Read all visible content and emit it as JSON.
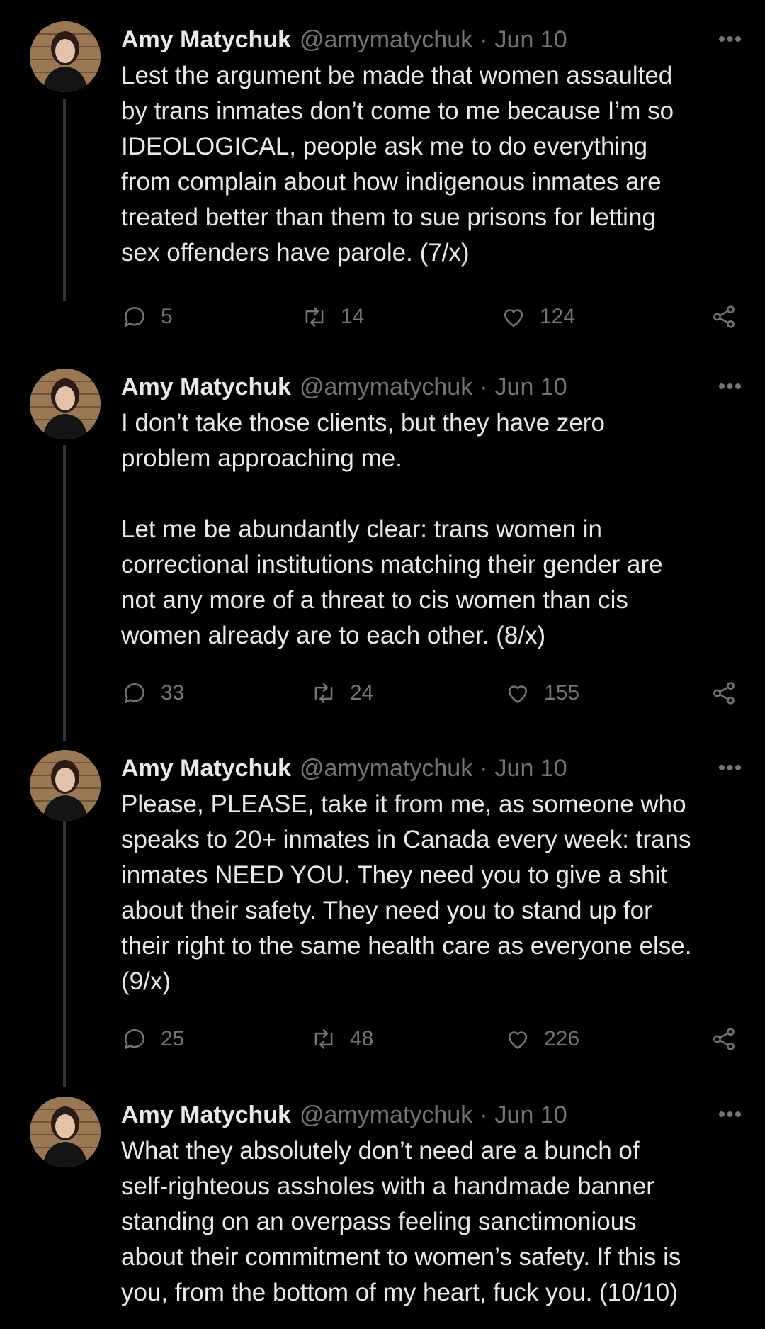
{
  "tweets": [
    {
      "name": "Amy Matychuk",
      "handle": "@amymatychuk",
      "separator": "·",
      "date": "Jun 10",
      "more": "•••",
      "text": "Lest the argument be made that women assaulted\nby trans inmates don’t come to me because I’m so\nIDEOLOGICAL, people ask me to do everything\nfrom complain about how indigenous inmates are\ntreated better than them to sue prisons for letting\nsex offenders have parole. (7/x)",
      "replies": "5",
      "retweets": "14",
      "likes": "124"
    },
    {
      "name": "Amy Matychuk",
      "handle": "@amymatychuk",
      "separator": "·",
      "date": "Jun 10",
      "more": "•••",
      "text": "I don’t take those clients, but they have zero\nproblem approaching me.\n\nLet me be abundantly clear: trans women in\ncorrectional institutions matching their gender are\nnot any more of a threat to cis women than cis\nwomen already are to each other. (8/x)",
      "replies": "33",
      "retweets": "24",
      "likes": "155"
    },
    {
      "name": "Amy Matychuk",
      "handle": "@amymatychuk",
      "separator": "·",
      "date": "Jun 10",
      "more": "•••",
      "text": "Please, PLEASE, take it from me, as someone who\nspeaks to 20+ inmates in Canada every week: trans\ninmates NEED YOU. They need you to give a shit\nabout their safety. They need you to stand up for\ntheir right to the same health care as everyone else.\n(9/x)",
      "replies": "25",
      "retweets": "48",
      "likes": "226"
    },
    {
      "name": "Amy Matychuk",
      "handle": "@amymatychuk",
      "separator": "·",
      "date": "Jun 10",
      "more": "•••",
      "text": "What they absolutely don’t need are a bunch of\nself-righteous assholes with a handmade banner\nstanding on an overpass feeling sanctimonious\nabout their commitment to women’s safety. If this is\nyou, from the bottom of my heart, fuck you. (10/10)"
    }
  ],
  "colors": {
    "background": "#000000",
    "text": "#e7e9ea",
    "secondary": "#71767b",
    "thread_line": "#333639"
  },
  "icons": {
    "reply": "reply-icon",
    "retweet": "retweet-icon",
    "like": "heart-icon",
    "share": "share-icon",
    "more": "more-icon"
  }
}
